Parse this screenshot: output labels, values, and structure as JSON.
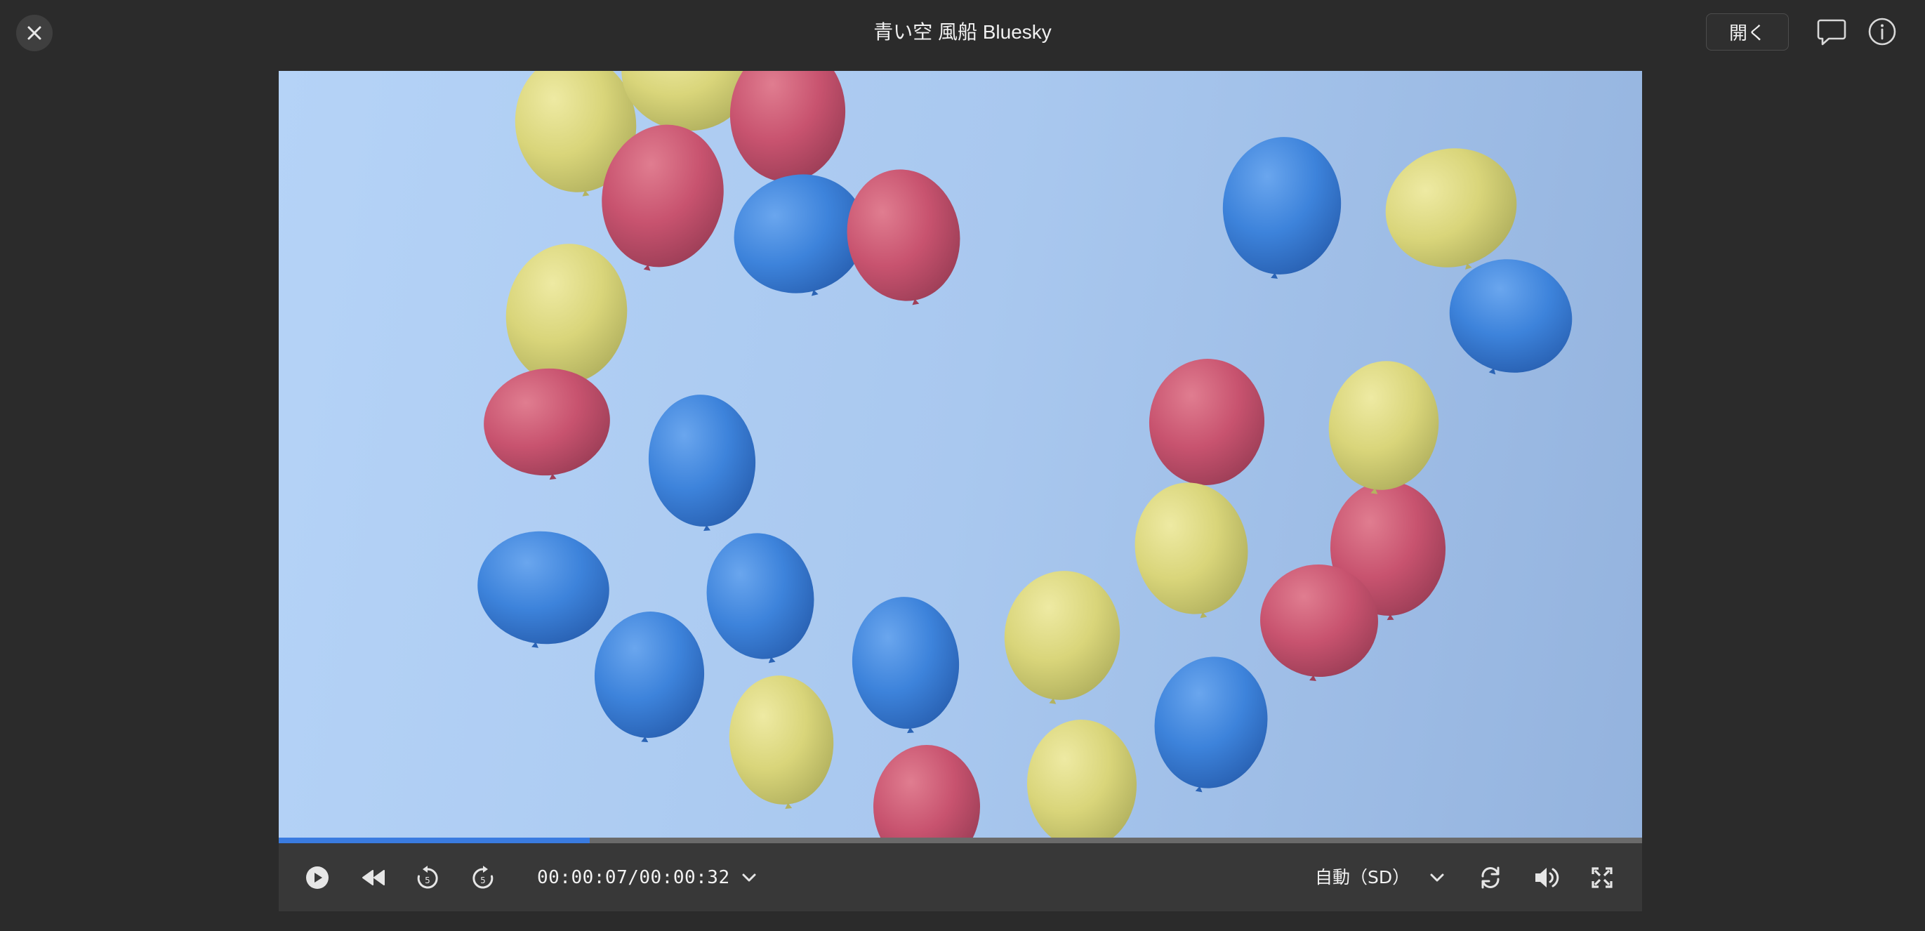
{
  "window": {
    "title": "青い空 風船 Bluesky",
    "open_button_label": "開く",
    "close_icon": "close-icon",
    "comment_icon": "speech-bubble-icon",
    "info_icon": "info-icon"
  },
  "player": {
    "time_display": "00:00:07/00:00:32",
    "progress": 0.228,
    "quality_label": "自動（SD）",
    "icons": [
      "play-icon",
      "rewind-icon",
      "replay-5-icon",
      "forward-5-icon",
      "chevron-down-icon",
      "chevron-down-icon",
      "loop-icon",
      "volume-icon",
      "fullscreen-icon"
    ]
  },
  "colors": {
    "background": "#2b2b2b",
    "player_bar": "#383838",
    "progress_fill": "#3a7be0",
    "progress_track": "#6a6a6a",
    "sky": "#acccf3",
    "balloon_red": "#c8536f",
    "balloon_yellow": "#d9d57a",
    "balloon_blue": "#3d83db"
  }
}
